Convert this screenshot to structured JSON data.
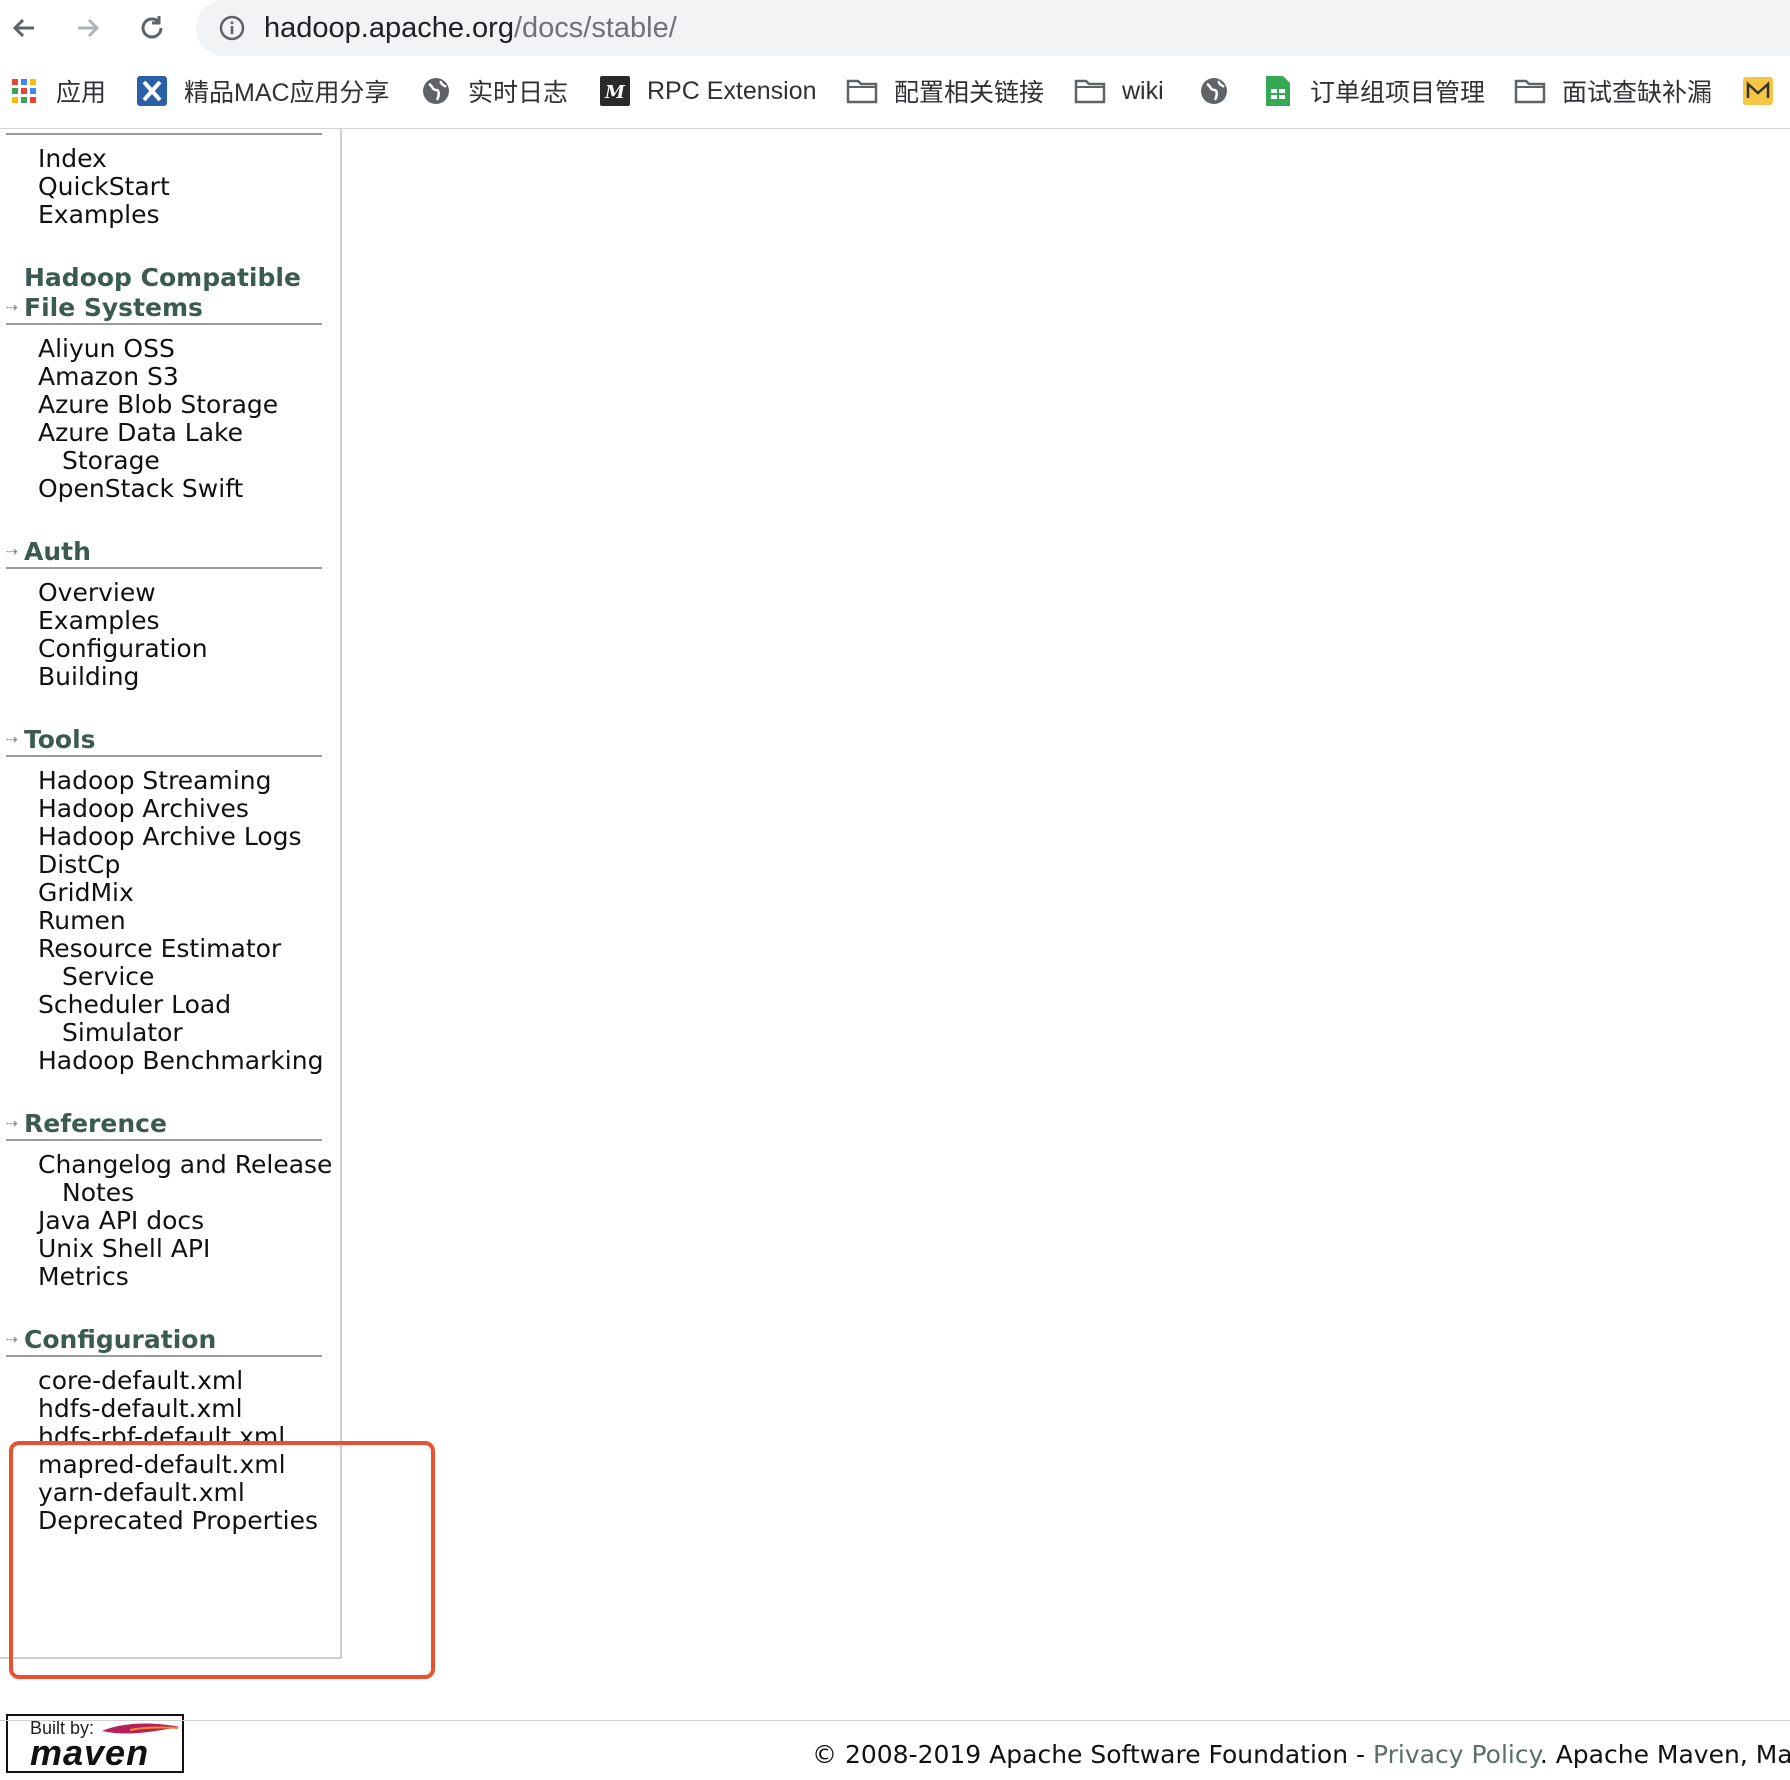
{
  "browser": {
    "url_host": "hadoop.apache.org",
    "url_path": "/docs/stable/",
    "bookmarks": [
      {
        "label": "应用",
        "icon": "apps-grid-icon"
      },
      {
        "label": "精品MAC应用分享",
        "icon": "x-app-icon"
      },
      {
        "label": "实时日志",
        "icon": "globe-icon"
      },
      {
        "label": "RPC Extension",
        "icon": "m-logo-icon"
      },
      {
        "label": "配置相关链接",
        "icon": "folder-icon"
      },
      {
        "label": "wiki",
        "icon": "folder-icon"
      },
      {
        "label": "",
        "icon": "globe-icon"
      },
      {
        "label": "订单组项目管理",
        "icon": "sheets-icon"
      },
      {
        "label": "面试查缺补漏",
        "icon": "folder-icon"
      },
      {
        "label": "",
        "icon": "mail-icon"
      }
    ]
  },
  "sidebar": {
    "top_items": [
      "Index",
      "QuickStart",
      "Examples"
    ],
    "sections": [
      {
        "title_lines": [
          "Hadoop Compatible",
          "File Systems"
        ],
        "items": [
          "Aliyun OSS",
          "Amazon S3",
          "Azure Blob Storage",
          "Azure Data Lake",
          "Storage",
          "OpenStack Swift"
        ]
      },
      {
        "title_lines": [
          "Auth"
        ],
        "items": [
          "Overview",
          "Examples",
          "Configuration",
          "Building"
        ]
      },
      {
        "title_lines": [
          "Tools"
        ],
        "items": [
          "Hadoop Streaming",
          "Hadoop Archives",
          "Hadoop Archive Logs",
          "DistCp",
          "GridMix",
          "Rumen",
          "Resource Estimator",
          "Service",
          "Scheduler Load",
          "Simulator",
          "Hadoop Benchmarking"
        ]
      },
      {
        "title_lines": [
          "Reference"
        ],
        "items": [
          "Changelog and Release",
          "Notes",
          "Java API docs",
          "Unix Shell API",
          "Metrics"
        ]
      },
      {
        "title_lines": [
          "Configuration"
        ],
        "items": [
          "core-default.xml",
          "hdfs-default.xml",
          "hdfs-rbf-default.xml",
          "mapred-default.xml",
          "yarn-default.xml",
          "Deprecated Properties"
        ]
      }
    ]
  },
  "badge": {
    "built_by": "Built by:",
    "brand": "maven"
  },
  "footer": {
    "copyright": "© 2008-2019 Apache Software Foundation - ",
    "privacy": "Privacy Policy",
    "rest": ". Apache Maven, Mave"
  },
  "colors": {
    "highlight": "#e8502f",
    "section_title": "#3a5a52"
  }
}
